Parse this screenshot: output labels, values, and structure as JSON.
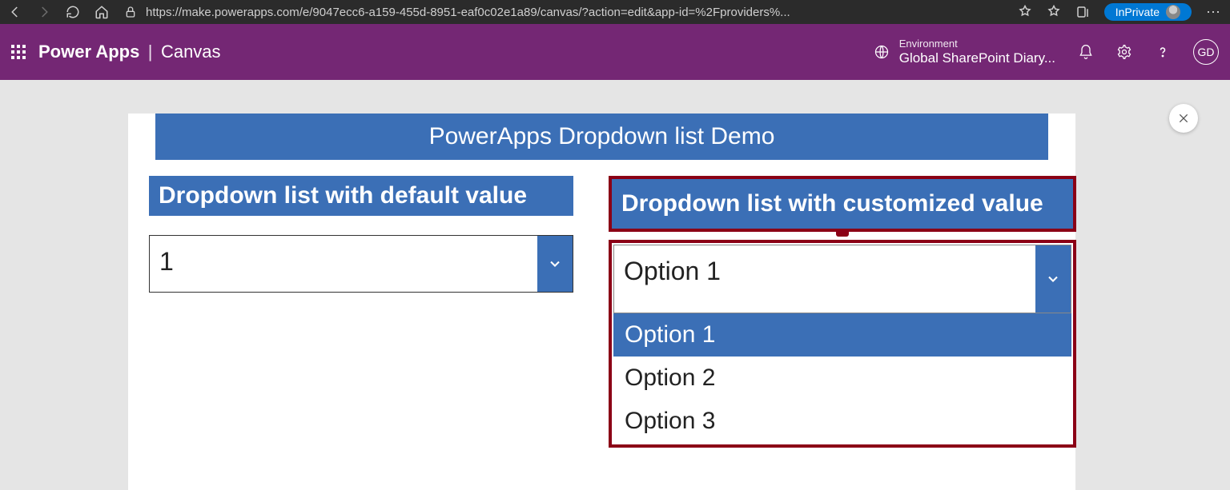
{
  "browser": {
    "url": "https://make.powerapps.com/e/9047ecc6-a159-455d-8951-eaf0c02e1a89/canvas/?action=edit&app-id=%2Fproviders%...",
    "inprivate_label": "InPrivate"
  },
  "header": {
    "product": "Power Apps",
    "separator": "|",
    "context": "Canvas",
    "environment_label": "Environment",
    "environment_name": "Global SharePoint Diary...",
    "user_initials": "GD"
  },
  "canvas": {
    "demo_title": "PowerApps Dropdown list Demo",
    "left": {
      "label": "Dropdown list with default value",
      "selected": "1"
    },
    "right": {
      "label": "Dropdown list with customized value",
      "selected": "Option 1",
      "options": [
        "Option 1",
        "Option 2",
        "Option 3"
      ]
    }
  }
}
